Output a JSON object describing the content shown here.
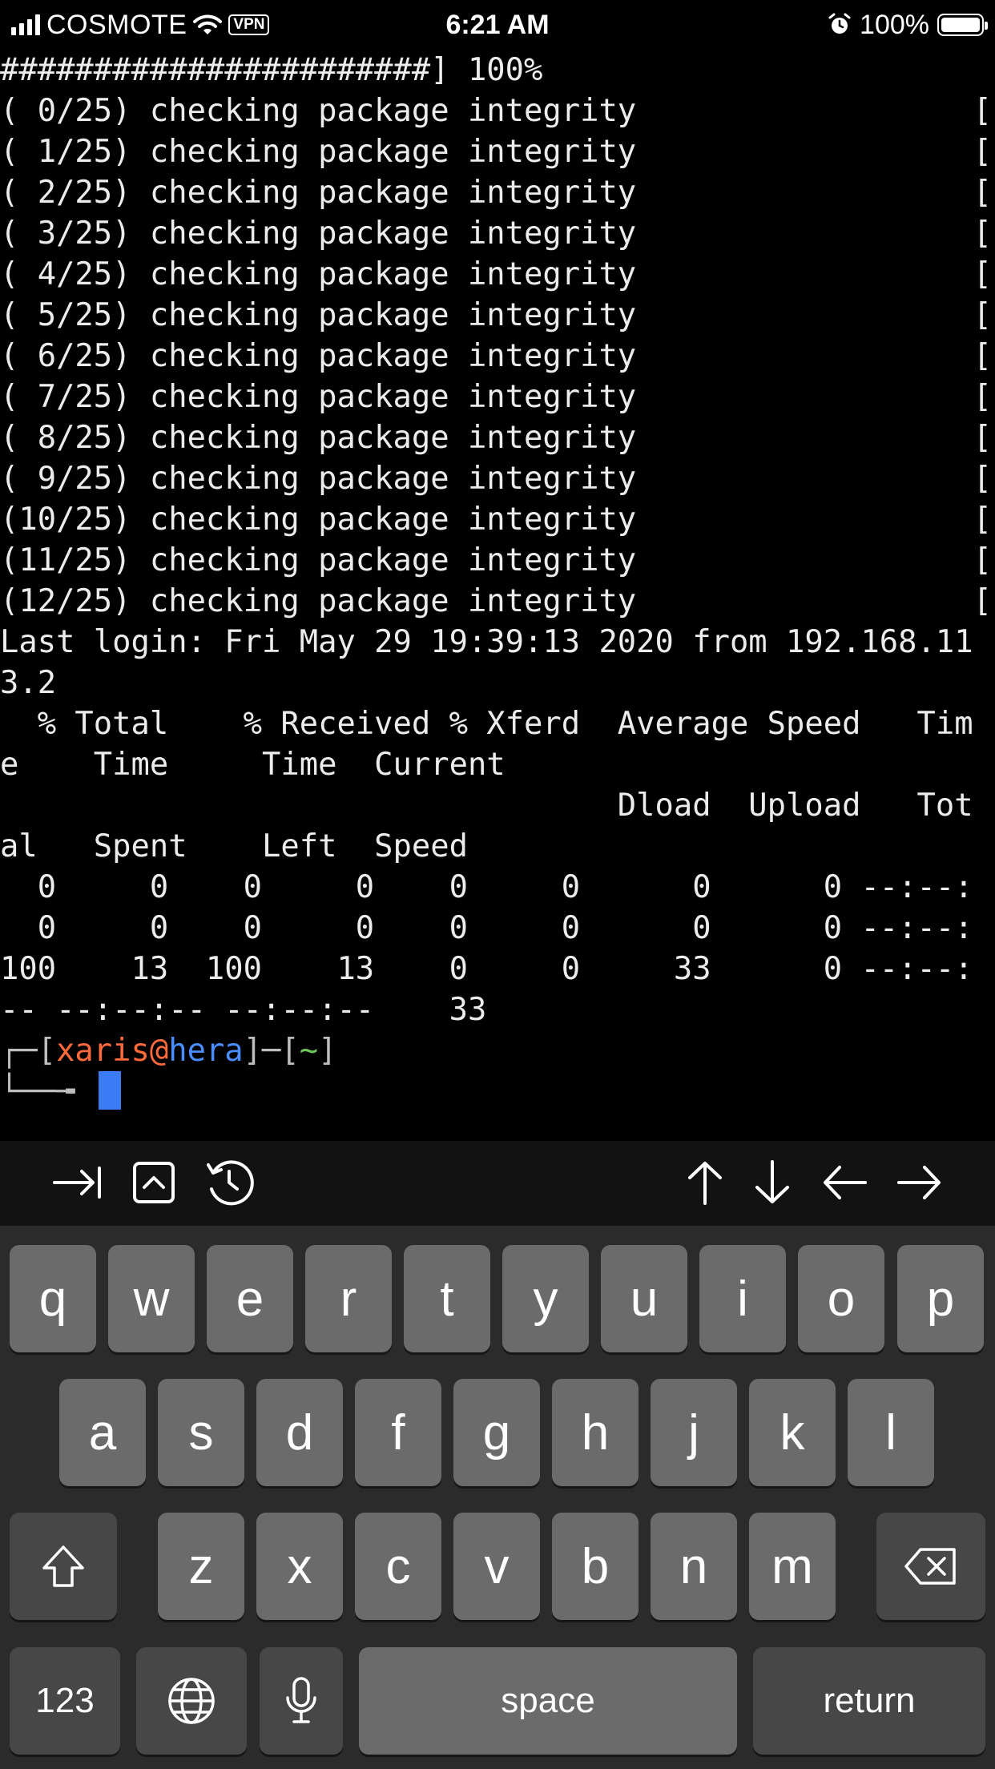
{
  "status_bar": {
    "carrier": "COSMOTE",
    "vpn": "VPN",
    "time": "6:21 AM",
    "battery": "100%",
    "battery_level": 1.0,
    "icons": [
      "signal-icon",
      "wifi-icon",
      "alarm-icon",
      "battery-icon"
    ]
  },
  "terminal": {
    "lines": [
      "#######################] 100%",
      "( 0/25) checking package integrity                  [",
      "( 1/25) checking package integrity                  [",
      "( 2/25) checking package integrity                  [",
      "( 3/25) checking package integrity                  [",
      "( 4/25) checking package integrity                  [",
      "( 5/25) checking package integrity                  [",
      "( 6/25) checking package integrity                  [",
      "( 7/25) checking package integrity                  [",
      "( 8/25) checking package integrity                  [",
      "( 9/25) checking package integrity                  [",
      "(10/25) checking package integrity                  [",
      "(11/25) checking package integrity                  [",
      "(12/25) checking package integrity                  [",
      "Last login: Fri May 29 19:39:13 2020 from 192.168.11",
      "3.2",
      "  % Total    % Received % Xferd  Average Speed   Tim",
      "e    Time     Time  Current",
      "                                 Dload  Upload   Tot",
      "al   Spent    Left  Speed",
      "  0     0    0     0    0     0      0      0 --:--:",
      "  0     0    0     0    0     0      0      0 --:--:",
      "100    13  100    13    0     0     33      0 --:--:",
      "-- --:--:-- --:--:--    33"
    ],
    "prompt": {
      "open_bracket": "┌─[",
      "user": "xaris",
      "at": "@",
      "host": "hera",
      "separator": "]─[",
      "path": "~",
      "close_bracket": "]",
      "second_line": "└──╼ "
    }
  },
  "toolbar": {
    "left_buttons": [
      "tab-icon",
      "control-icon",
      "history-icon"
    ],
    "right_buttons": [
      "arrow-up-icon",
      "arrow-down-icon",
      "arrow-left-icon",
      "arrow-right-icon"
    ]
  },
  "keyboard": {
    "row1": [
      "q",
      "w",
      "e",
      "r",
      "t",
      "y",
      "u",
      "i",
      "o",
      "p"
    ],
    "row2": [
      "a",
      "s",
      "d",
      "f",
      "g",
      "h",
      "j",
      "k",
      "l"
    ],
    "row3": [
      "z",
      "x",
      "c",
      "v",
      "b",
      "n",
      "m"
    ],
    "numbers_label": "123",
    "space_label": "space",
    "return_label": "return"
  }
}
